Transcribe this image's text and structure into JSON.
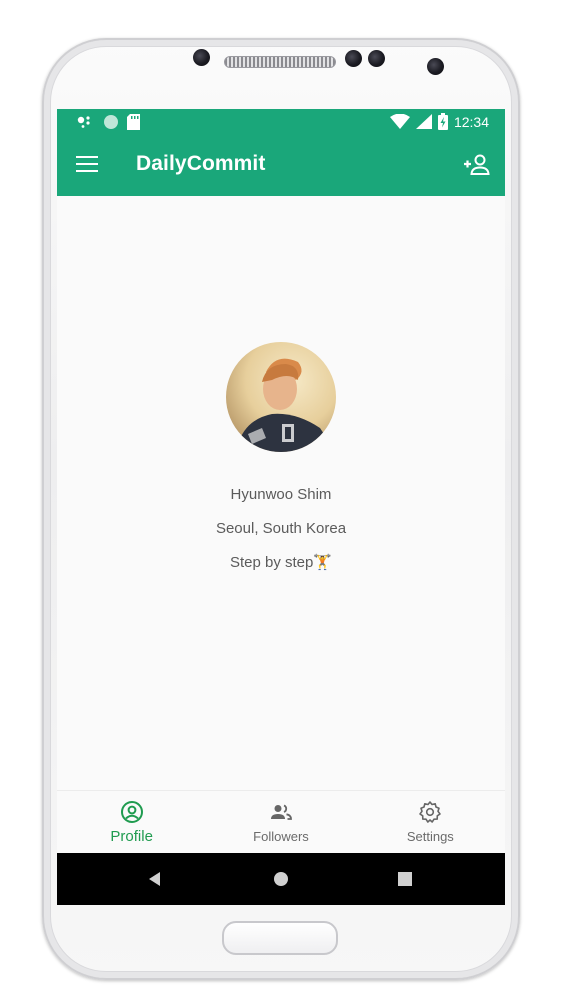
{
  "status_bar": {
    "time": "12:34",
    "icons": [
      "assistant-dots-icon",
      "circle-indicator-icon",
      "sd-card-icon",
      "wifi-icon",
      "cell-signal-icon",
      "battery-charging-icon"
    ]
  },
  "app_bar": {
    "title": "DailyCommit",
    "menu_icon": "hamburger-menu-icon",
    "action_icon": "add-person-icon"
  },
  "profile": {
    "name": "Hyunwoo Shim",
    "location": "Seoul, South Korea",
    "bio": "Step by step🏋"
  },
  "bottom_nav": {
    "items": [
      {
        "label": "Profile",
        "icon": "account-circle-icon",
        "active": true
      },
      {
        "label": "Followers",
        "icon": "people-icon",
        "active": false
      },
      {
        "label": "Settings",
        "icon": "gear-icon",
        "active": false
      }
    ]
  },
  "system_nav": {
    "icons": [
      "back-triangle-icon",
      "home-circle-icon",
      "recents-square-icon"
    ]
  },
  "colors": {
    "primary": "#1aa77a",
    "active_nav": "#1f9b4f",
    "text_secondary": "#5b5b5b"
  }
}
